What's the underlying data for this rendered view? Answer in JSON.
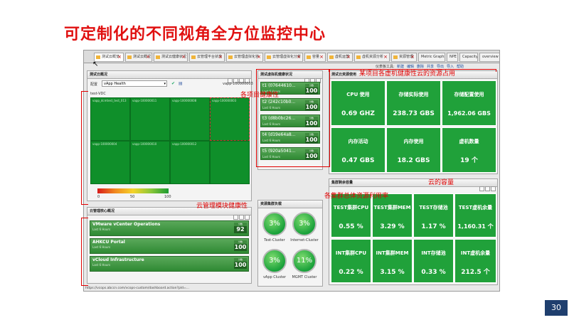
{
  "slide": {
    "title": "可定制化的不同视角全方位监控中心",
    "page_number": "30"
  },
  "browser": {
    "tabs": [
      {
        "label": "测试云概览",
        "active": true
      },
      {
        "label": "测试云概况"
      },
      {
        "label": "测试云健康状况"
      },
      {
        "label": "云管理平台状态"
      },
      {
        "label": "云管理虚拟化容"
      },
      {
        "label": "云管理虚拟化分析"
      },
      {
        "label": "容量"
      },
      {
        "label": "虚机运营"
      },
      {
        "label": "虚机资源分析"
      },
      {
        "label": "资源管理"
      },
      {
        "label": "Metric Graphs"
      },
      {
        "label": "NPE"
      },
      {
        "label": "Capacity"
      },
      {
        "label": "overview"
      }
    ],
    "toolbar_links": {
      "label": "仪表板工具:",
      "items": [
        "新建",
        "编辑",
        "删除",
        "共享",
        "导出",
        "导入",
        "帮助"
      ]
    },
    "status_url": "https://vcops.abccn.com/vcops-custom/dashboard.action?pId=..."
  },
  "heatmap_panel": {
    "title": "测试云概况",
    "filter_label": "配置",
    "filter_value": "vApp Health",
    "right_text": "vapp-100000003",
    "group_label": "test-VDC",
    "cells": [
      {
        "label": "vapp_dcmtest_test_013"
      },
      {
        "label": "vapp-100000011"
      },
      {
        "label": "vapp-100000008"
      },
      {
        "label": "vapp-100000003"
      },
      {
        "label": "vapp-100000004"
      },
      {
        "label": "vapp-100000010"
      },
      {
        "label": "vapp-100000012"
      },
      {
        "label": ""
      }
    ],
    "scale_labels": [
      "0",
      "50",
      "100"
    ]
  },
  "vm_panel": {
    "title": "测试虚拟机健康状况",
    "rows": [
      {
        "name": "t1 (07644610...",
        "sub": "Last 6 Hours",
        "score": "100"
      },
      {
        "name": "t2 (242c10b0...",
        "sub": "Last 6 Hours",
        "score": "100"
      },
      {
        "name": "t3 (d8b0bc26...",
        "sub": "Last 6 Hours",
        "score": "100"
      },
      {
        "name": "t4 (d19e64a8...",
        "sub": "Last 6 Hours",
        "score": "100"
      },
      {
        "name": "t5 (920a5041...",
        "sub": "Last 6 Hours",
        "score": "100"
      }
    ],
    "score_header": "分数"
  },
  "resource_panel": {
    "title": "测试云资源使用",
    "tiles": [
      {
        "label": "CPU 使用",
        "value": "0.69 GHZ"
      },
      {
        "label": "存储实际使用",
        "value": "238.73 GBS"
      },
      {
        "label": "存储配置使用",
        "value": "1,962.06 GBS"
      },
      {
        "label": "内存活动",
        "value": "0.47 GBS"
      },
      {
        "label": "内存使用",
        "value": "18.2 GBS"
      },
      {
        "label": "虚机数量",
        "value": "19 个"
      }
    ]
  },
  "capacity_panel": {
    "title": "集群剩余容量",
    "tiles": [
      {
        "label": "TEST集群CPU",
        "value": "0.55 %"
      },
      {
        "label": "TEST集群MEM",
        "value": "3.29 %"
      },
      {
        "label": "TEST存储池",
        "value": "1.17 %"
      },
      {
        "label": "TEST虚机余量",
        "value": "1,160.31 个"
      },
      {
        "label": "INT集群CPU",
        "value": "0.22 %"
      },
      {
        "label": "INT集群MEM",
        "value": "3.15 %"
      },
      {
        "label": "INT存储池",
        "value": "0.33 %"
      },
      {
        "label": "INT虚机余量",
        "value": "212.5 个"
      }
    ]
  },
  "cloud_mgmt_panel": {
    "title": "云管理核心概况",
    "rows": [
      {
        "name": "VMware vCenter Operations",
        "sub": "Last 6 Hours",
        "score": "92"
      },
      {
        "name": "AHKCU Portal",
        "sub": "Last 6 Hours",
        "score": "100"
      },
      {
        "name": "vCloud Infrastructure",
        "sub": "Last 6 Hours",
        "score": "100"
      }
    ],
    "score_header": "分数"
  },
  "cluster_panel": {
    "title": "资源集群负载",
    "items": [
      {
        "value": "3%",
        "label": "Test-Cluster"
      },
      {
        "value": "3%",
        "label": "Internet-Cluster"
      },
      {
        "value": "3%",
        "label": "vApp Cluster"
      },
      {
        "value": "11%",
        "label": "MGMT Cluster"
      }
    ]
  },
  "annotations": {
    "vm_resource": "某项目各虚机健康性云的资源占用",
    "project_health": "各项目健康性",
    "cloud_capacity": "云的容量",
    "cluster_load": "各集群总体资源利用率",
    "cloud_mgmt": "云管理模块健康性"
  },
  "colors": {
    "title_red": "#e01010",
    "tile_green": "#20a13a",
    "annotation_red": "#e00000",
    "page_badge": "#1f3f6e"
  }
}
